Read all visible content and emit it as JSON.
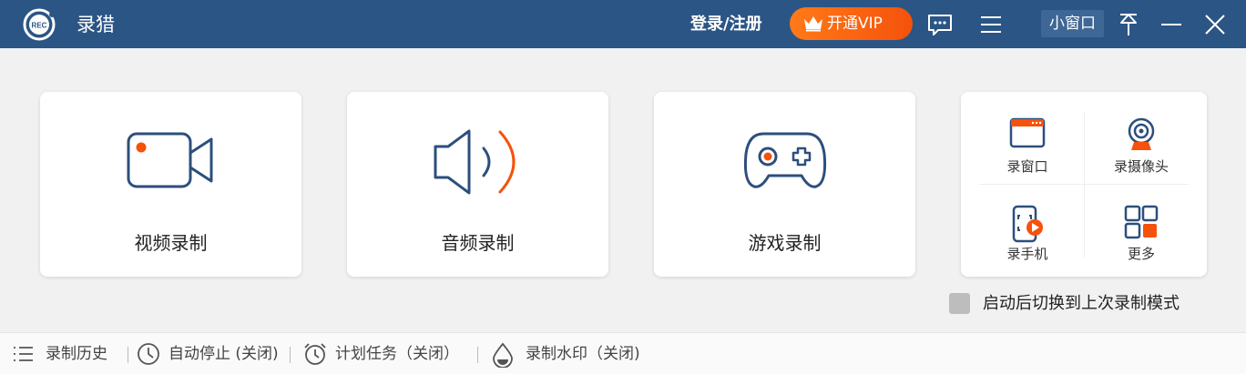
{
  "titlebar": {
    "app_title": "录猎",
    "logo_text": "REC",
    "login_label": "登录/注册",
    "vip_label": "开通VIP",
    "mini_window_label": "小窗口",
    "icons": [
      "chat-icon",
      "menu-icon",
      "pin-icon",
      "minimize-icon",
      "close-icon"
    ]
  },
  "cards": [
    {
      "label": "视频录制",
      "icon": "video-camera-icon"
    },
    {
      "label": "音频录制",
      "icon": "speaker-icon"
    },
    {
      "label": "游戏录制",
      "icon": "gamepad-icon"
    }
  ],
  "side_panel": {
    "items": [
      {
        "label": "录窗口",
        "icon": "window-icon"
      },
      {
        "label": "录摄像头",
        "icon": "webcam-icon"
      },
      {
        "label": "录手机",
        "icon": "phone-icon"
      },
      {
        "label": "更多",
        "icon": "grid-icon"
      }
    ]
  },
  "startup_option": {
    "label": "启动后切换到上次录制模式",
    "checked": false
  },
  "bottombar": {
    "items": [
      {
        "label": "录制历史",
        "icon": "list-icon"
      },
      {
        "label": "自动停止 (关闭)",
        "icon": "clock-icon"
      },
      {
        "label": "计划任务（关闭）",
        "icon": "alarm-icon"
      },
      {
        "label": "录制水印（关闭)",
        "icon": "droplet-icon"
      }
    ]
  },
  "colors": {
    "titlebar_bg": "#2b5585",
    "accent_orange": "#f5520c",
    "icon_blue": "#2c4f7c"
  }
}
